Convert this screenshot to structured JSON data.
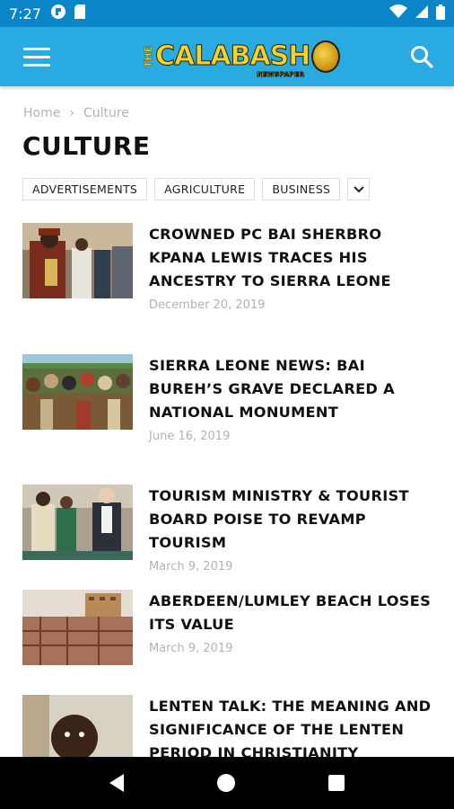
{
  "status": {
    "time": "7:27"
  },
  "header": {
    "logo_the": "THE",
    "logo_main": "CALABASH",
    "logo_sub": "NEWSPAPER"
  },
  "breadcrumb": {
    "home": "Home",
    "separator": "›",
    "current": "Culture"
  },
  "page_title": "CULTURE",
  "categories": [
    "ADVERTISEMENTS",
    "AGRICULTURE",
    "BUSINESS"
  ],
  "articles": [
    {
      "title": "CROWNED PC BAI SHERBRO KPANA LEWIS TRACES HIS ANCESTRY TO SIERRA LEONE",
      "date": "December 20, 2019"
    },
    {
      "title": "SIERRA LEONE NEWS: BAI BUREH’S GRAVE DECLARED A NATIONAL MONUMENT",
      "date": "June 16, 2019"
    },
    {
      "title": "TOURISM MINISTRY & TOURIST BOARD POISE TO REVAMP TOURISM",
      "date": "March 9, 2019"
    },
    {
      "title": "ABERDEEN/LUMLEY BEACH LOSES ITS VALUE",
      "date": "March 9, 2019"
    },
    {
      "title": "LENTEN TALK: THE MEANING AND SIGNIFICANCE OF THE LENTEN PERIOD IN CHRISTIANITY",
      "date": ""
    }
  ],
  "colors": {
    "status_bar": "#0a85c7",
    "header": "#29aae1",
    "logo": "#f6d12a"
  },
  "icons": {
    "menu": "menu-icon",
    "search": "search-icon",
    "more_categories": "chevron-down-icon"
  }
}
